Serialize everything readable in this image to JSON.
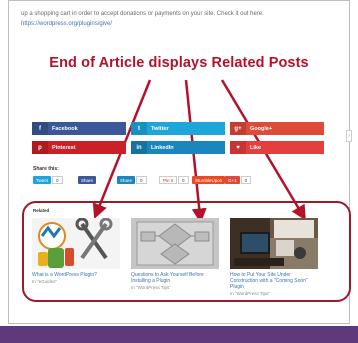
{
  "intro": {
    "text": "up a shopping cart in order to accept donations or payments on your site. Check it out here:",
    "link": "https://wordpress.org/plugins/give/"
  },
  "annotation": {
    "headline": "End of Article displays Related Posts",
    "color": "#b4122a"
  },
  "share_buttons": [
    {
      "label": "Facebook",
      "icon": "facebook-icon",
      "glyph": "f",
      "color": "#3b5998"
    },
    {
      "label": "Twitter",
      "icon": "twitter-icon",
      "glyph": "t",
      "color": "#1ea6db"
    },
    {
      "label": "Google+",
      "icon": "google-plus-icon",
      "glyph": "g+",
      "color": "#dd4b39"
    },
    {
      "label": "Pinterest",
      "icon": "pinterest-icon",
      "glyph": "p",
      "color": "#cb2027"
    },
    {
      "label": "LinkedIn",
      "icon": "linkedin-icon",
      "glyph": "in",
      "color": "#1b86bc"
    },
    {
      "label": "Like",
      "icon": "heart-icon",
      "glyph": "♥",
      "color": "#e33f3f"
    }
  ],
  "share_this": {
    "label": "Share this:",
    "buttons": [
      {
        "label": "Tweet",
        "count": "0"
      },
      {
        "label": "Share",
        "count": ""
      },
      {
        "label": "Share",
        "count": "0"
      },
      {
        "label": "Pin it",
        "count": "0"
      },
      {
        "label": "StumbleUpon",
        "count": ""
      },
      {
        "label": "G+1",
        "count": "0"
      }
    ]
  },
  "related": {
    "label": "Related",
    "posts": [
      {
        "title": "What is a WordPress Plugin?",
        "category": "In \"eGuides\""
      },
      {
        "title": "Questions to Ask Yourself Before Installing a Plugin",
        "category": "In \"WordPress Tips\""
      },
      {
        "title": "How to Put Your Site Under Construction with a \"Coming Soon\" Plugin",
        "category": "In \"WordPress Tips\""
      }
    ]
  }
}
